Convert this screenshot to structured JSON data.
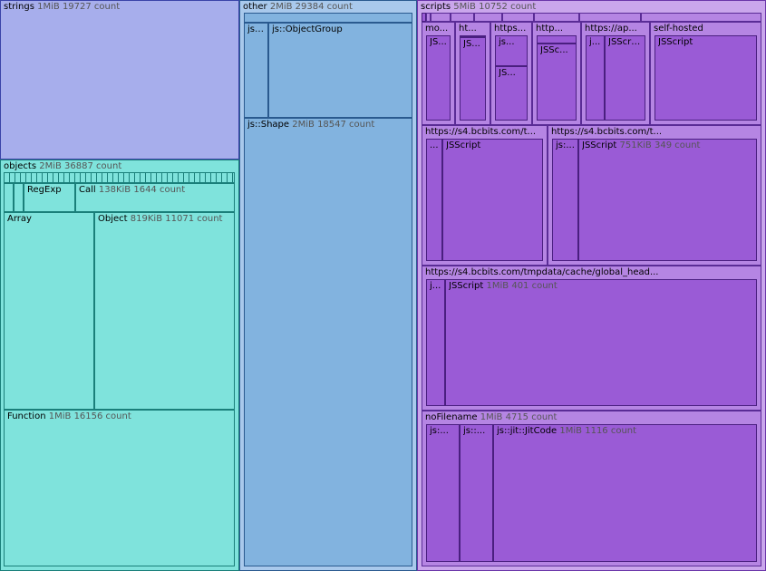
{
  "strings": {
    "name": "strings",
    "size": "1MiB",
    "count": "19727 count"
  },
  "objects": {
    "name": "objects",
    "size": "2MiB",
    "count": "36887 count",
    "regexp": "RegExp",
    "call": {
      "name": "Call",
      "size": "138KiB",
      "count": "1644 count"
    },
    "array": "Array",
    "object": {
      "name": "Object",
      "size": "819KiB",
      "count": "11071 count"
    },
    "function": {
      "name": "Function",
      "size": "1MiB",
      "count": "16156 count"
    }
  },
  "other": {
    "name": "other",
    "size": "2MiB",
    "count": "29384 count",
    "js_small": "js:...",
    "object_group": "js::ObjectGroup",
    "shape": {
      "name": "js::Shape",
      "size": "2MiB",
      "count": "18547 count"
    }
  },
  "scripts": {
    "name": "scripts",
    "size": "5MiB",
    "count": "10752 count",
    "row1": {
      "mo": "mo...",
      "mo_js": "JS...",
      "ht": "ht...",
      "ht_js": "JS...",
      "https": "https...",
      "https_js1": "js...",
      "https_js2": "JS...",
      "http": "http...",
      "http_js": "JSSc...",
      "ap": "https://ap...",
      "ap_j": "j...",
      "ap_jsscript": "JSScript",
      "self_hosted": "self-hosted",
      "self_hosted_js": "JSScript"
    },
    "s4a": {
      "name": "https://s4.bcbits.com/t...",
      "small": "...",
      "jsscript": "JSScript"
    },
    "s4b": {
      "name": "https://s4.bcbits.com/t...",
      "small": "js:...",
      "jsscript": {
        "name": "JSScript",
        "size": "751KiB",
        "count": "349 count"
      }
    },
    "global": {
      "name": "https://s4.bcbits.com/tmpdata/cache/global_head...",
      "small": "j...",
      "jsscript": {
        "name": "JSScript",
        "size": "1MiB",
        "count": "401 count"
      }
    },
    "nofile": {
      "name": "noFilename",
      "size": "1MiB",
      "count": "4715 count",
      "js1": "js:...",
      "js2": "js::...",
      "jit": {
        "name": "js::jit::JitCode",
        "size": "1MiB",
        "count": "1116 count"
      }
    }
  }
}
